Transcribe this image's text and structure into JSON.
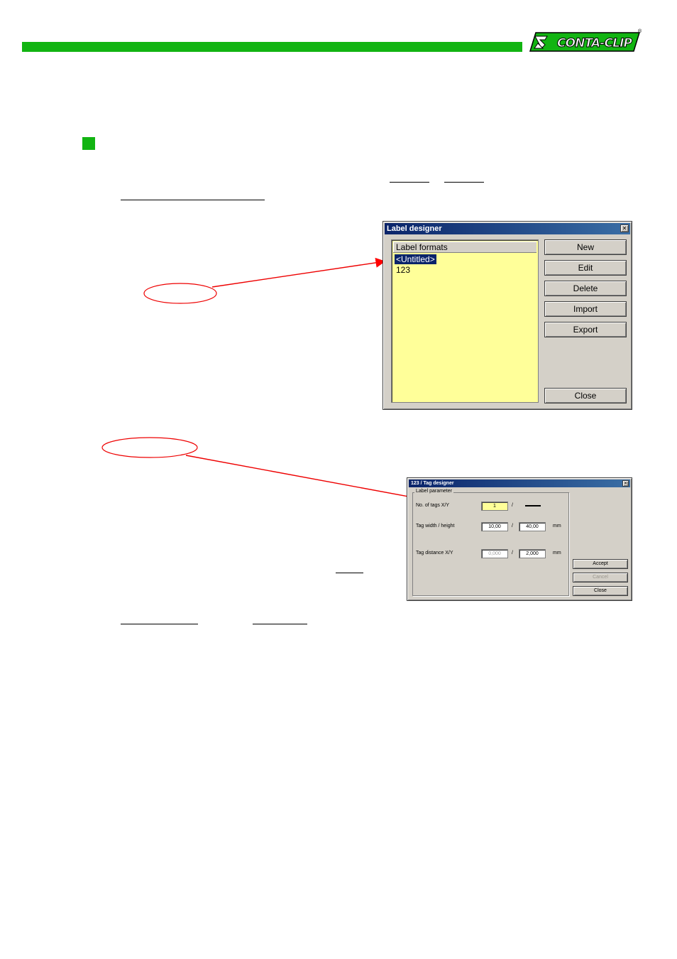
{
  "header": {
    "accent_color": "#12b412",
    "logo_text": "CONTA-CLIP",
    "registered": "®"
  },
  "label_designer": {
    "title": "Label designer",
    "close_glyph": "✕",
    "list_header": "Label formats",
    "items": [
      "<Untitled>",
      "123"
    ],
    "buttons": {
      "new_label": "New",
      "edit_label": "Edit",
      "delete_label": "Delete",
      "import_label": "Import",
      "export_label": "Export",
      "close_label": "Close"
    }
  },
  "tag_designer": {
    "title": "123 / Tag designer",
    "close_glyph": "✕",
    "group_label": "Label parameter",
    "rows": {
      "tags_xy_label": "No. of tags X/Y",
      "tags_x_value": "1",
      "width_height_label": "Tag width / height",
      "width_value": "10,00",
      "height_value": "40,00",
      "distance_label": "Tag distance X/Y",
      "distance_x_value": "0,000",
      "distance_y_value": "2,000",
      "separator": "/",
      "unit": "mm"
    },
    "buttons": {
      "accept_label": "Accept",
      "cancel_label": "Cancel",
      "close_label": "Close"
    }
  }
}
